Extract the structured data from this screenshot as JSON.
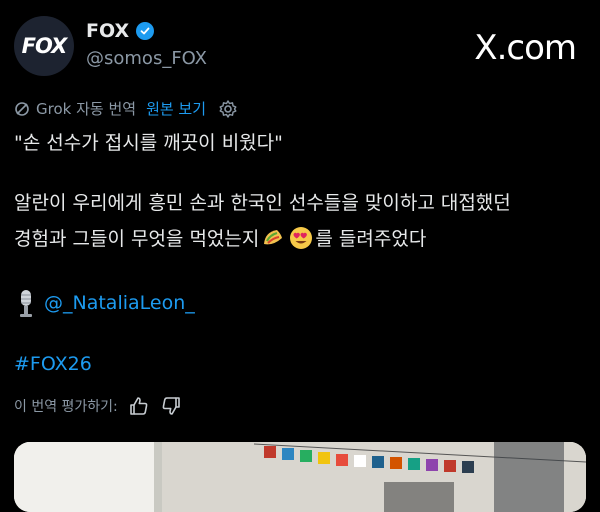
{
  "author": {
    "avatar_text": "FOX",
    "display_name": "FOX",
    "handle": "@somos_FOX"
  },
  "watermark": "X.com",
  "translation": {
    "grok_label": "Grok 자동 번역",
    "original_link": "원본 보기"
  },
  "post": {
    "quote": "\"손 선수가 접시를 깨끗이 비웠다\"",
    "line1": "알란이 우리에게 흥민 손과 한국인 선수들을 맞이하고 대접했던",
    "line2_start": "경험과 그들이 무엇을 먹었는지",
    "line2_end": "를 들려주었다",
    "mention": "@_NataliaLeon_",
    "hashtag": "#FOX26"
  },
  "rating": {
    "label": "이 번역 평가하기:"
  },
  "icons": {
    "verified": "verified-badge-icon",
    "grok": "grok-icon",
    "gear": "gear-icon",
    "taco": "taco-emoji",
    "heart_eyes": "heart-eyes-emoji",
    "mic": "microphone-emoji",
    "thumbs_up": "thumbs-up-icon",
    "thumbs_down": "thumbs-down-icon"
  },
  "colors": {
    "background": "#000000",
    "link": "#1d9bf0",
    "secondary": "#8b98a5"
  }
}
